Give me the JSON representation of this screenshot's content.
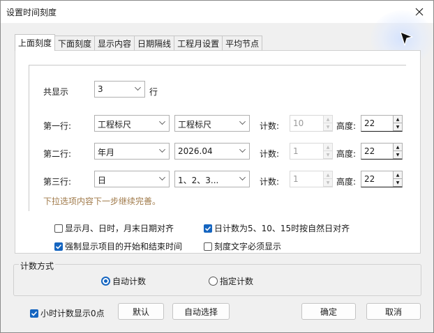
{
  "window": {
    "title": "设置时间刻度"
  },
  "tabs": [
    {
      "label": "上面刻度",
      "active": true
    },
    {
      "label": "下面刻度",
      "active": false
    },
    {
      "label": "显示内容",
      "active": false
    },
    {
      "label": "日期隔线",
      "active": false
    },
    {
      "label": "工程月设置",
      "active": false
    },
    {
      "label": "平均节点",
      "active": false
    }
  ],
  "display": {
    "label": "共显示",
    "value": "3",
    "unit": "行"
  },
  "common": {
    "count_label": "计数:",
    "height_label": "高度:"
  },
  "rows": [
    {
      "label": "第一行:",
      "type": "工程标尺",
      "format": "工程标尺",
      "count": "10",
      "height": "22"
    },
    {
      "label": "第二行:",
      "type": "年月",
      "format": "2026.04",
      "count": "1",
      "height": "22"
    },
    {
      "label": "第三行:",
      "type": "日",
      "format": "1、2、3...",
      "count": "1",
      "height": "22"
    }
  ],
  "hint": "下拉选项内容下一步继续完善。",
  "options": [
    {
      "label": "显示月、日时，月末日期对齐",
      "checked": false
    },
    {
      "label": "日计数为5、10、15时按自然日对齐",
      "checked": true
    },
    {
      "label": "强制显示项目的开始和结束时间",
      "checked": true
    },
    {
      "label": "刻度文字必须显示",
      "checked": false
    }
  ],
  "count_mode": {
    "legend": "计数方式",
    "options": [
      {
        "label": "自动计数",
        "selected": true
      },
      {
        "label": "指定计数",
        "selected": false
      }
    ]
  },
  "footer": {
    "hour_zero": {
      "label": "小时计数显示0点",
      "checked": true
    },
    "default_label": "默认",
    "auto_select_label": "自动选择",
    "ok_label": "确定",
    "cancel_label": "取消"
  },
  "colors": {
    "accent": "#1565c0",
    "hint": "#a07a4a"
  },
  "icons": {
    "close": "close-icon",
    "cursor": "cursor-arrow-icon",
    "dropdown": "chevron-down-icon",
    "check": "checkmark-icon"
  }
}
